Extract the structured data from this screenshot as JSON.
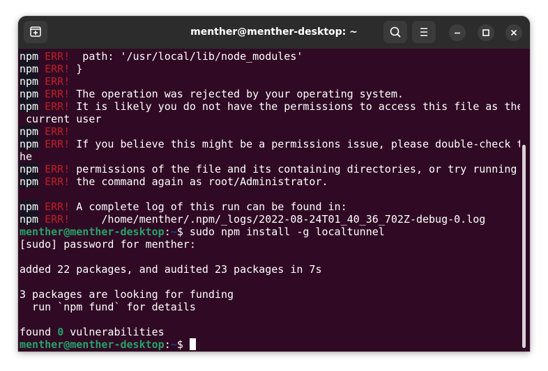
{
  "window": {
    "title": "menther@menther-desktop: ~"
  },
  "header": {
    "new_tab_icon": "new-tab-icon",
    "search_icon": "search-icon",
    "menu_icon": "hamburger-menu-icon",
    "minimize_icon": "minimize-icon",
    "maximize_icon": "maximize-icon",
    "close_icon": "close-icon"
  },
  "colors": {
    "terminal_bg": "#300a24",
    "err_red": "#c01c28",
    "prompt_green": "#26a269",
    "prompt_blue": "#12488b",
    "titlebar": "#2c2c2c"
  },
  "terminal": {
    "npm": "npm",
    "err": "ERR!",
    "prompt_user": "menther@menther-desktop",
    "prompt_sep": ":",
    "prompt_path": "~",
    "prompt_dollar": "$ ",
    "lines": {
      "l1": "  path: '/usr/local/lib/node_modules'",
      "l2": " }",
      "l3": "",
      "l4": " The operation was rejected by your operating system.",
      "l5": " It is likely you do not have the permissions to access this file as the",
      "l6": " current user",
      "l7": "",
      "l8": " If you believe this might be a permissions issue, please double-check t",
      "l9": "he",
      "l10": " permissions of the file and its containing directories, or try running",
      "l11": " the command again as root/Administrator.",
      "l13": " A complete log of this run can be found in:",
      "l14": "     /home/menther/.npm/_logs/2022-08-24T01_40_36_702Z-debug-0.log",
      "l15_cmd": "sudo npm install -g localtunnel",
      "l16": "[sudo] password for menther:",
      "l18": "added 22 packages, and audited 23 packages in 7s",
      "l20": "3 packages are looking for funding",
      "l21": "  run `npm fund` for details",
      "l23a": "found ",
      "l23b": "0",
      "l23c": " vulnerabilities"
    }
  }
}
